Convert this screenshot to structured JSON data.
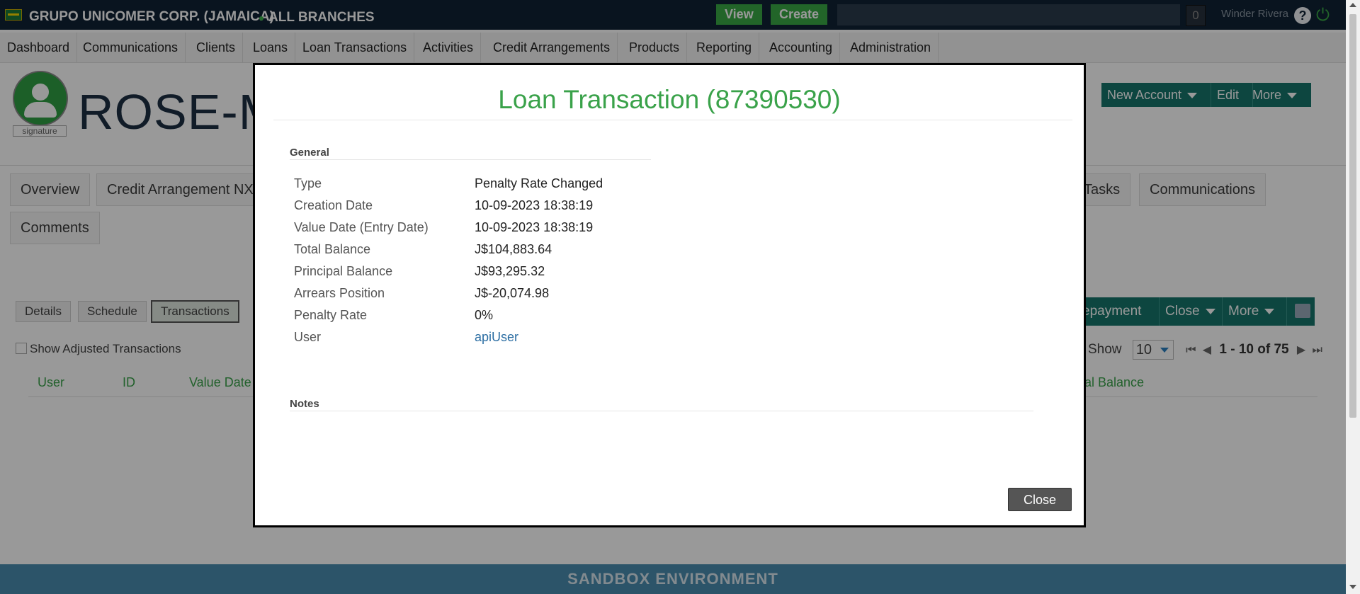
{
  "header": {
    "org_name": "GRUPO UNICOMER CORP. (JAMAICA)",
    "branch": "ALL BRANCHES",
    "view_label": "View",
    "create_label": "Create",
    "notifications_count": "0",
    "user_name": "Winder Rivera",
    "help_icon": "question-circle-icon",
    "power_icon": "power-icon"
  },
  "nav": {
    "items": [
      "Dashboard",
      "Communications",
      "Clients",
      "Loans",
      "Loan Transactions",
      "Activities",
      "Credit Arrangements",
      "Products",
      "Reporting",
      "Accounting",
      "Administration"
    ]
  },
  "client": {
    "avatar_label": "signature",
    "name_visible": "ROSE-MA",
    "actions": [
      "New Account",
      "Edit",
      "More"
    ],
    "tabs": [
      "Overview",
      "Credit Arrangement NX",
      "Tasks",
      "Communications",
      "Comments"
    ]
  },
  "loan": {
    "sub_tabs": [
      "Details",
      "Schedule",
      "Transactions"
    ],
    "active_sub_tab": "Transactions",
    "toolbar": [
      "epayment",
      "Close",
      "More"
    ],
    "show_adjusted_label": "Show Adjusted Transactions",
    "page_size_label": "Show",
    "page_size": "10",
    "range": "1 - 10 of 75",
    "columns": [
      "User",
      "ID",
      "Value Date",
      "al Balance"
    ]
  },
  "modal": {
    "title": "Loan Transaction (87390530)",
    "general_label": "General",
    "notes_label": "Notes",
    "rows": [
      {
        "label": "Type",
        "value": "Penalty Rate Changed"
      },
      {
        "label": "Creation Date",
        "value": "10-09-2023 18:38:19"
      },
      {
        "label": "Value Date (Entry Date)",
        "value": "10-09-2023 18:38:19"
      },
      {
        "label": "Total Balance",
        "value": "J$104,883.64"
      },
      {
        "label": "Principal Balance",
        "value": "J$93,295.32"
      },
      {
        "label": "Arrears Position",
        "value": "J$-20,074.98"
      },
      {
        "label": "Penalty Rate",
        "value": "0%"
      },
      {
        "label": "User",
        "value": "apiUser"
      }
    ],
    "close_label": "Close"
  },
  "footer": {
    "environment": "SANDBOX ENVIRONMENT"
  },
  "colors": {
    "header_bg": "#0f2234",
    "accent_green": "#3aa24a",
    "teal": "#16766c",
    "sandbox_bar": "#4a8db0"
  }
}
